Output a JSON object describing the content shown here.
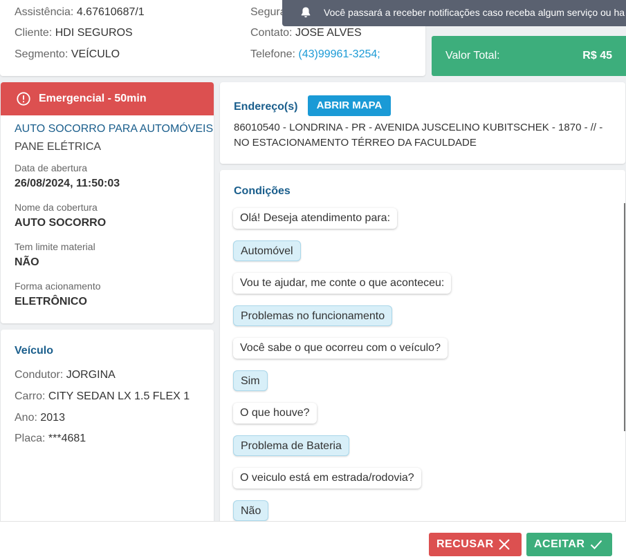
{
  "top": {
    "assistance_label": "Assistência:",
    "assistance_value": "4.67610687/1",
    "client_label": "Cliente:",
    "client_value": "HDI SEGUROS",
    "segment_label": "Segmento:",
    "segment_value": "VEÍCULO",
    "insured_label": "Segura",
    "contact_label": "Contato:",
    "contact_value": "JOSE ALVES",
    "phone_label": "Telefone:",
    "phone_value": "(43)99961-3254;"
  },
  "total": {
    "label": "Valor Total:",
    "value": "R$ 45"
  },
  "toast": {
    "message": "Você passará a receber notificações caso receba algum serviço ou ha"
  },
  "emergency": {
    "header": "Emergencial - 50min",
    "service_title": "AUTO SOCORRO PARA AUTOMÓVEIS",
    "service_subtitle": "PANE ELÉTRICA",
    "fields": [
      {
        "label": "Data de abertura",
        "value": "26/08/2024, 11:50:03"
      },
      {
        "label": "Nome da cobertura",
        "value": "AUTO SOCORRO"
      },
      {
        "label": "Tem limite material",
        "value": "NÃO"
      },
      {
        "label": "Forma acionamento",
        "value": "ELETRÔNICO"
      }
    ]
  },
  "vehicle": {
    "title": "Veículo",
    "driver_label": "Condutor:",
    "driver_value": "JORGINA",
    "car_label": "Carro:",
    "car_value": "CITY SEDAN LX 1.5 FLEX 1",
    "year_label": "Ano:",
    "year_value": "2013",
    "plate_label": "Placa:",
    "plate_value": "***4681"
  },
  "address": {
    "title": "Endereço(s)",
    "map_button": "ABRIR MAPA",
    "line1": "86010540 - LONDRINA - PR - AVENIDA JUSCELINO KUBITSCHEK - 1870 - // -",
    "line2": "NO ESTACIONAMENTO TÉRREO DA FACULDADE"
  },
  "conditions": {
    "title": "Condições",
    "messages": [
      {
        "type": "q",
        "text": "Olá! Deseja atendimento para:"
      },
      {
        "type": "a",
        "text": "Automóvel"
      },
      {
        "type": "q",
        "text": "Vou te ajudar, me conte o que aconteceu:"
      },
      {
        "type": "a",
        "text": "Problemas no funcionamento"
      },
      {
        "type": "q",
        "text": "Você sabe o que ocorreu com o veículo?"
      },
      {
        "type": "a",
        "text": "Sim"
      },
      {
        "type": "q",
        "text": "O que houve?"
      },
      {
        "type": "a",
        "text": "Problema de Bateria"
      },
      {
        "type": "q",
        "text": "O veiculo está em estrada/rodovia?"
      },
      {
        "type": "a",
        "text": "Não"
      }
    ]
  },
  "footer": {
    "refuse_label": "RECUSAR",
    "accept_label": "ACEITAR"
  },
  "colors": {
    "danger": "#dc5050",
    "success": "#3dae7c",
    "accent": "#1a9ad6",
    "title": "#1a5e8c"
  },
  "icons": {
    "toast": "bell-icon",
    "emergency": "alert-circle-icon",
    "refuse": "close-icon",
    "accept": "check-icon"
  }
}
